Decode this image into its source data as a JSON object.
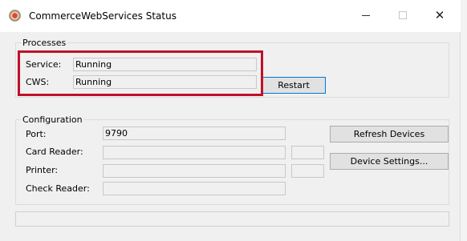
{
  "window": {
    "title": "CommerceWebServices Status",
    "controls": {
      "minimize": "—",
      "maximize": "☐",
      "close": "✕"
    }
  },
  "processes": {
    "group_label": "Processes",
    "service_label": "Service:",
    "service_value": "Running",
    "cws_label": "CWS:",
    "cws_value": "Running",
    "restart_label": "Restart"
  },
  "configuration": {
    "group_label": "Configuration",
    "port_label": "Port:",
    "port_value": "9790",
    "card_reader_label": "Card Reader:",
    "card_reader_value": "",
    "card_reader_extra": "",
    "printer_label": "Printer:",
    "printer_value": "",
    "printer_extra": "",
    "check_reader_label": "Check Reader:",
    "check_reader_value": "",
    "refresh_devices_label": "Refresh Devices",
    "device_settings_label": "Device Settings..."
  },
  "status_bar": {
    "text": ""
  },
  "colors": {
    "highlight": "#c0102a",
    "focus": "#0078d7"
  }
}
